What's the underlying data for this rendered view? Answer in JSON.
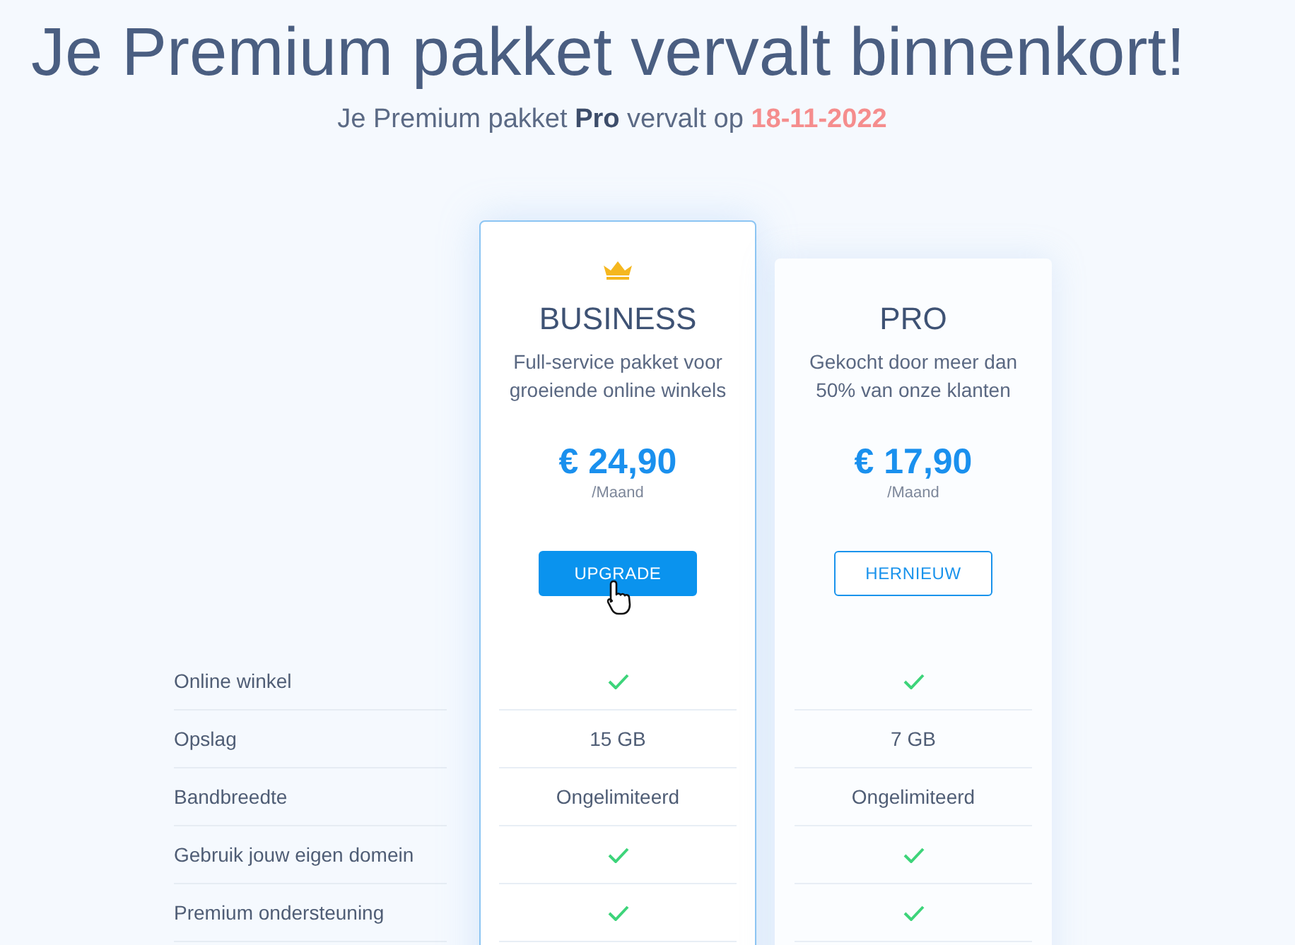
{
  "heading": "Je Premium pakket vervalt binnenkort!",
  "subtitle": {
    "text": "Je Premium pakket **Pro** vervalt op",
    "date": "18-11-2022"
  },
  "features": [
    "Online winkel",
    "Opslag",
    "Bandbreedte",
    "Gebruik jouw eigen domein",
    "Premium ondersteuning"
  ],
  "plans": [
    {
      "featured": true,
      "name": "BUSINESS",
      "description": "Full-service pakket voor groeiende online winkels",
      "price": "€ 24,90",
      "period": "/Maand",
      "button": {
        "label": "UPGRADE",
        "kind": "primary",
        "hovered": true
      },
      "cells": [
        {
          "kind": "check"
        },
        {
          "kind": "text",
          "text": "15 GB"
        },
        {
          "kind": "text",
          "text": "Ongelimiteerd"
        },
        {
          "kind": "check"
        },
        {
          "kind": "check"
        }
      ]
    },
    {
      "featured": false,
      "name": "PRO",
      "description": "Gekocht door meer dan 50% van onze klanten",
      "price": "€ 17,90",
      "period": "/Maand",
      "button": {
        "label": "HERNIEUW",
        "kind": "outline",
        "hovered": false
      },
      "cells": [
        {
          "kind": "check"
        },
        {
          "kind": "text",
          "text": "7 GB"
        },
        {
          "kind": "text",
          "text": "Ongelimiteerd"
        },
        {
          "kind": "check"
        },
        {
          "kind": "check"
        }
      ]
    }
  ]
}
